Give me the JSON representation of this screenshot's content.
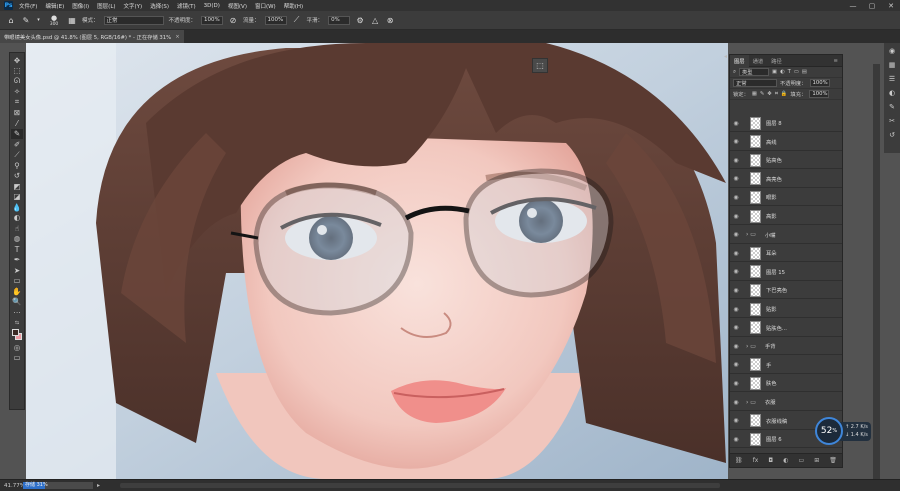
{
  "app": {
    "logo": "Ps"
  },
  "menu": [
    "文件(F)",
    "编辑(E)",
    "图像(I)",
    "图层(L)",
    "文字(Y)",
    "选择(S)",
    "滤镜(T)",
    "3D(D)",
    "视图(V)",
    "窗口(W)",
    "帮助(H)"
  ],
  "window_controls": {
    "minimize": "—",
    "maximize": "▢",
    "close": "✕"
  },
  "options": {
    "brush_size": "300",
    "mode_label": "模式：",
    "mode_value": "正常",
    "opacity_label": "不透明度：",
    "opacity_value": "100%",
    "flow_label": "流量：",
    "flow_value": "100%",
    "smooth_label": "平滑：",
    "smooth_value": "0%"
  },
  "document_tab": {
    "title": "带眼镜美女头像.psd @ 41.8% (图层 5, RGB/16#) * - 正在存储 31%",
    "close": "×"
  },
  "status": {
    "zoom": "41.77%",
    "progress_text": "存储 31%",
    "progress": 0.31
  },
  "layers_panel": {
    "tabs": [
      "图层",
      "通道",
      "路径"
    ],
    "filter_label": "类型",
    "blend_mode": "正常",
    "opacity_label": "不透明度：",
    "opacity_value": "100%",
    "lock_label": "锁定：",
    "fill_label": "填充：",
    "fill_value": "100%",
    "layers": [
      {
        "name": "图层 8",
        "type": "layer"
      },
      {
        "name": "高线",
        "type": "layer"
      },
      {
        "name": "贴高色",
        "type": "layer"
      },
      {
        "name": "高亮色",
        "type": "layer"
      },
      {
        "name": "眼影",
        "type": "layer"
      },
      {
        "name": "高影",
        "type": "layer"
      },
      {
        "name": "小嘴",
        "type": "group"
      },
      {
        "name": "耳朵",
        "type": "layer"
      },
      {
        "name": "图层 15",
        "type": "layer"
      },
      {
        "name": "下巴亮色",
        "type": "layer"
      },
      {
        "name": "贴影",
        "type": "layer"
      },
      {
        "name": "贴肤色...",
        "type": "layer"
      },
      {
        "name": "手背",
        "type": "group"
      },
      {
        "name": "手",
        "type": "layer"
      },
      {
        "name": "肤色",
        "type": "layer"
      },
      {
        "name": "衣服",
        "type": "group"
      },
      {
        "name": "衣服线稿",
        "type": "layer"
      },
      {
        "name": "图层 6",
        "type": "layer"
      }
    ]
  },
  "perf": {
    "value": "52",
    "unit": "%",
    "up": "2.7",
    "up_unit": "K/s",
    "down": "1.4",
    "down_unit": "K/s"
  },
  "colors": {
    "foreground": "#3b2a25",
    "background": "#ec9aa3",
    "accent": "#2f70c9"
  }
}
